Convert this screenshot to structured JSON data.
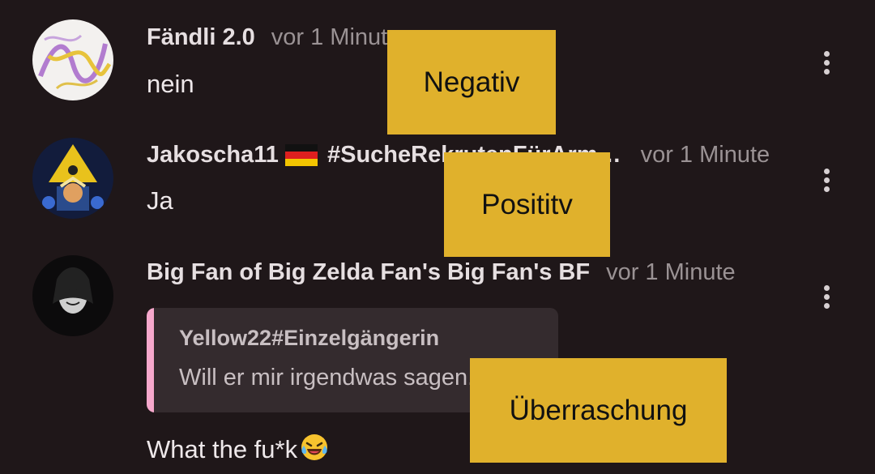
{
  "comments": [
    {
      "username": "Fändli 2.0",
      "time": "vor 1 Minute",
      "text": "nein",
      "avatar_icon": "scribble-avatar-icon"
    },
    {
      "username": "Jakoscha11",
      "username_suffix": " #SucheRekrutenFürArm…",
      "flag_icon": "germany-flag-icon",
      "time": "vor 1 Minute",
      "text": "Ja",
      "avatar_icon": "anime-character-avatar-icon"
    },
    {
      "username": "Big Fan of Big Zelda Fan's Big Fan's BF",
      "time": "vor 1 Minute",
      "quote": {
        "author": "Yellow22#Einzelgängerin",
        "text": "Will er mir irgendwas sagen...?"
      },
      "text": "What the fu*k",
      "emoji_icon": "laughing-tears-emoji-icon",
      "avatar_icon": "masked-face-avatar-icon"
    }
  ],
  "labels": {
    "label_1": "Negativ",
    "label_2": "Posititv",
    "label_3": "Überraschung"
  },
  "colors": {
    "background": "#1f1719",
    "label": "#e0b12c",
    "quote_bar": "#f6a8cc",
    "quote_background": "#342b2e"
  }
}
